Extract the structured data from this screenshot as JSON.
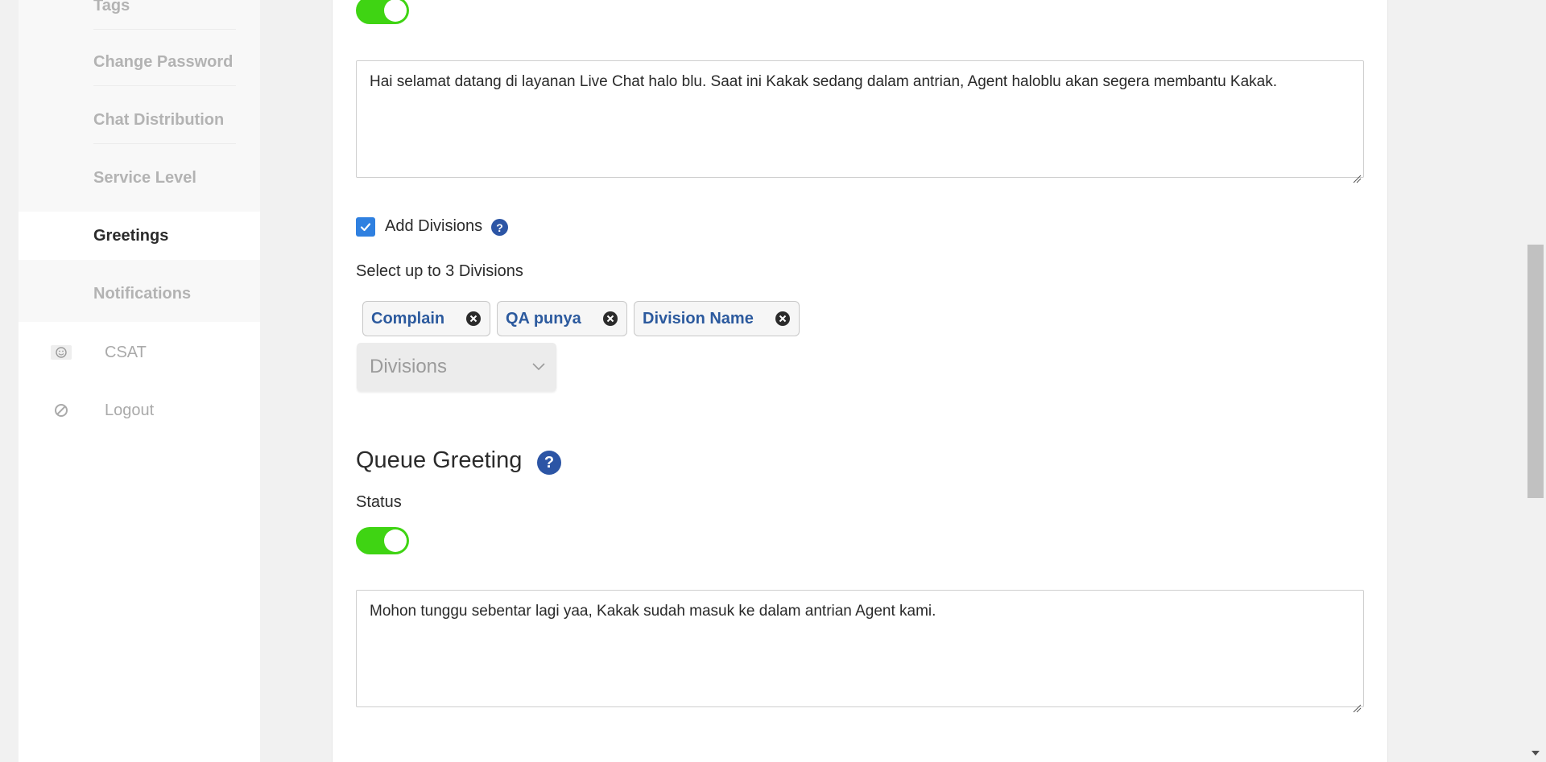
{
  "sidebar": {
    "sub_items": [
      {
        "label": "Tags"
      },
      {
        "label": "Change Password"
      },
      {
        "label": "Chat Distribution"
      },
      {
        "label": "Service Level"
      },
      {
        "label": "Greetings"
      },
      {
        "label": "Notifications"
      }
    ],
    "active_item": "Greetings",
    "main_items": [
      {
        "label": "CSAT",
        "icon": "smiley-icon"
      },
      {
        "label": "Logout",
        "icon": "logout-icon"
      }
    ]
  },
  "greeting": {
    "status_on": true,
    "message": "Hai selamat datang di layanan Live Chat halo blu. Saat ini Kakak sedang dalam antrian, Agent haloblu akan segera membantu Kakak.",
    "add_divisions_label": "Add Divisions",
    "add_divisions_checked": true,
    "divisions_hint": "Select up to 3 Divisions",
    "selected_divisions": [
      "Complain",
      "QA punya",
      "Division Name"
    ],
    "divisions_placeholder": "Divisions"
  },
  "queue_greeting": {
    "title": "Queue Greeting",
    "status_label": "Status",
    "status_on": true,
    "message": "Mohon tunggu sebentar lagi yaa, Kakak sudah masuk ke dalam antrian Agent kami."
  },
  "colors": {
    "toggle_on": "#3fd413",
    "chip_text": "#2c5a9e",
    "help_icon": "#2c55a5",
    "checkbox": "#2f80e0"
  }
}
